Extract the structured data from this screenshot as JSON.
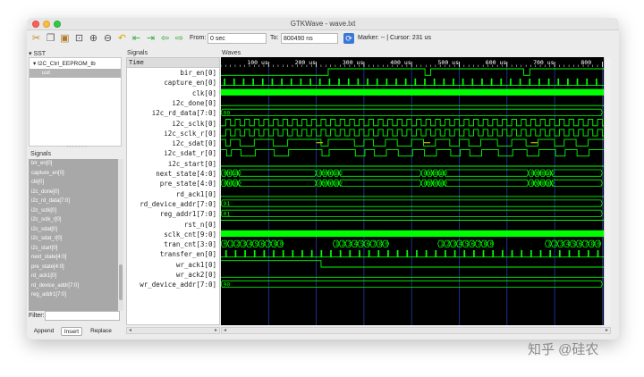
{
  "window": {
    "title": "GTKWave - wave.lxt"
  },
  "toolbar": {
    "from_label": "From:",
    "from_value": "0 sec",
    "to_label": "To:",
    "to_value": "800490 ns",
    "marker_label": "Marker: -- | Cursor: 231 us",
    "icons": [
      "cut-icon",
      "copy-icon",
      "paste-icon",
      "zoom-fit-icon",
      "zoom-in-icon",
      "zoom-out-icon",
      "undo-zoom-icon",
      "go-start-icon",
      "go-end-icon",
      "step-back-icon",
      "step-forward-icon",
      "reload-icon"
    ]
  },
  "sst": {
    "header": "SST",
    "tree": [
      {
        "label": "I2C_Ctrl_EEPROM_tb",
        "selected": false
      },
      {
        "label": "uut",
        "selected": true
      }
    ]
  },
  "signals_list": {
    "header": "Signals",
    "items": [
      "bir_en[0]",
      "capture_en[0]",
      "clk[0]",
      "i2c_done[0]",
      "i2c_rd_data[7:0]",
      "i2c_sclk[0]",
      "i2c_sclk_r[0]",
      "i2c_sdat[0]",
      "i2c_sdat_r[0]",
      "i2c_start[0]",
      "next_state[4:0]",
      "pre_state[4:0]",
      "rd_ack1[0]",
      "rd_device_addr[7:0]",
      "reg_addr1[7:0]"
    ]
  },
  "filter": {
    "label": "Filter:"
  },
  "buttons": {
    "append": "Append",
    "insert": "Insert",
    "replace": "Replace"
  },
  "signals_pane": {
    "header": "Signals",
    "time_label": "Time",
    "names": [
      "bir_en[0]",
      "capture_en[0]",
      "clk[0]",
      "i2c_done[0]",
      "i2c_rd_data[7:0]",
      "i2c_sclk[0]",
      "i2c_sclk_r[0]",
      "i2c_sdat[0]",
      "i2c_sdat_r[0]",
      "i2c_start[0]",
      "next_state[4:0]",
      "pre_state[4:0]",
      "rd_ack1[0]",
      "rd_device_addr[7:0]",
      "reg_addr1[7:0]",
      "rst_n[0]",
      "sclk_cnt[9:0]",
      "tran_cnt[3:0]",
      "transfer_en[0]",
      "wr_ack1[0]",
      "wr_ack2[0]",
      "wr_device_addr[7:0]"
    ]
  },
  "waves": {
    "header": "Waves",
    "time_labels": [
      "100 us",
      "200 us",
      "300 us",
      "400 us",
      "500 us",
      "600 us",
      "700 us",
      "800"
    ],
    "bus_values": {
      "i2c_rd_data": "00",
      "rd_device_addr": "91",
      "reg_addr1": "01",
      "wr_device_addr": "90",
      "state_groups": [
        "00",
        "01",
        "02",
        "03",
        "00",
        "01",
        "02",
        "03",
        "00",
        "01",
        "02",
        "03",
        "00",
        "01",
        "02"
      ],
      "tran_cnt_first": "0",
      "tran_cnt_digits": [
        "1",
        "2",
        "3",
        "4",
        "5",
        "6",
        "7",
        "8",
        "0"
      ]
    },
    "colors": {
      "trace": "#00ff00",
      "background": "#000000",
      "grid": "#1f3fa8",
      "highlight": "#f0d800"
    }
  },
  "watermark": {
    "text": "知乎 @硅农"
  }
}
